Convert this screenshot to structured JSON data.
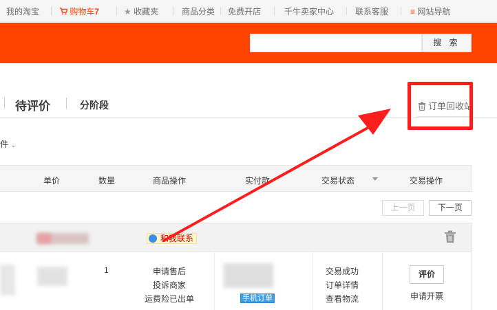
{
  "topbar": {
    "my_taobao": "我的淘宝",
    "cart_label": "购物车",
    "cart_count": "7",
    "favorites": "收藏夹",
    "categories": "商品分类",
    "open_shop": "免费开店",
    "seller_center": "千牛卖家中心",
    "customer_service": "联系客服",
    "site_nav": "网站导航"
  },
  "search": {
    "button_label": "搜 索",
    "value": ""
  },
  "tabs": {
    "pending_review": "待评价",
    "installment": "分阶段",
    "recycle_bin": "订单回收站"
  },
  "filter": {
    "label": "条件"
  },
  "table_header": {
    "unit_price": "单价",
    "quantity": "数量",
    "item_actions": "商品操作",
    "paid": "实付款",
    "status": "交易状态",
    "order_actions": "交易操作"
  },
  "pager": {
    "prev": "上一页",
    "next": "下一页"
  },
  "order": {
    "contact_label": "和我联系",
    "quantity": "1",
    "after_sale": "申请售后",
    "complain": "投诉商家",
    "shipping_insurance": "运费险已出单",
    "mobile_order": "手机订单",
    "status_success": "交易成功",
    "order_details": "订单详情",
    "view_logistics": "查看物流",
    "review_button": "评价",
    "request_invoice": "申请开票"
  },
  "colors": {
    "brand": "#ff4400",
    "annotation": "#ff1e1e"
  }
}
